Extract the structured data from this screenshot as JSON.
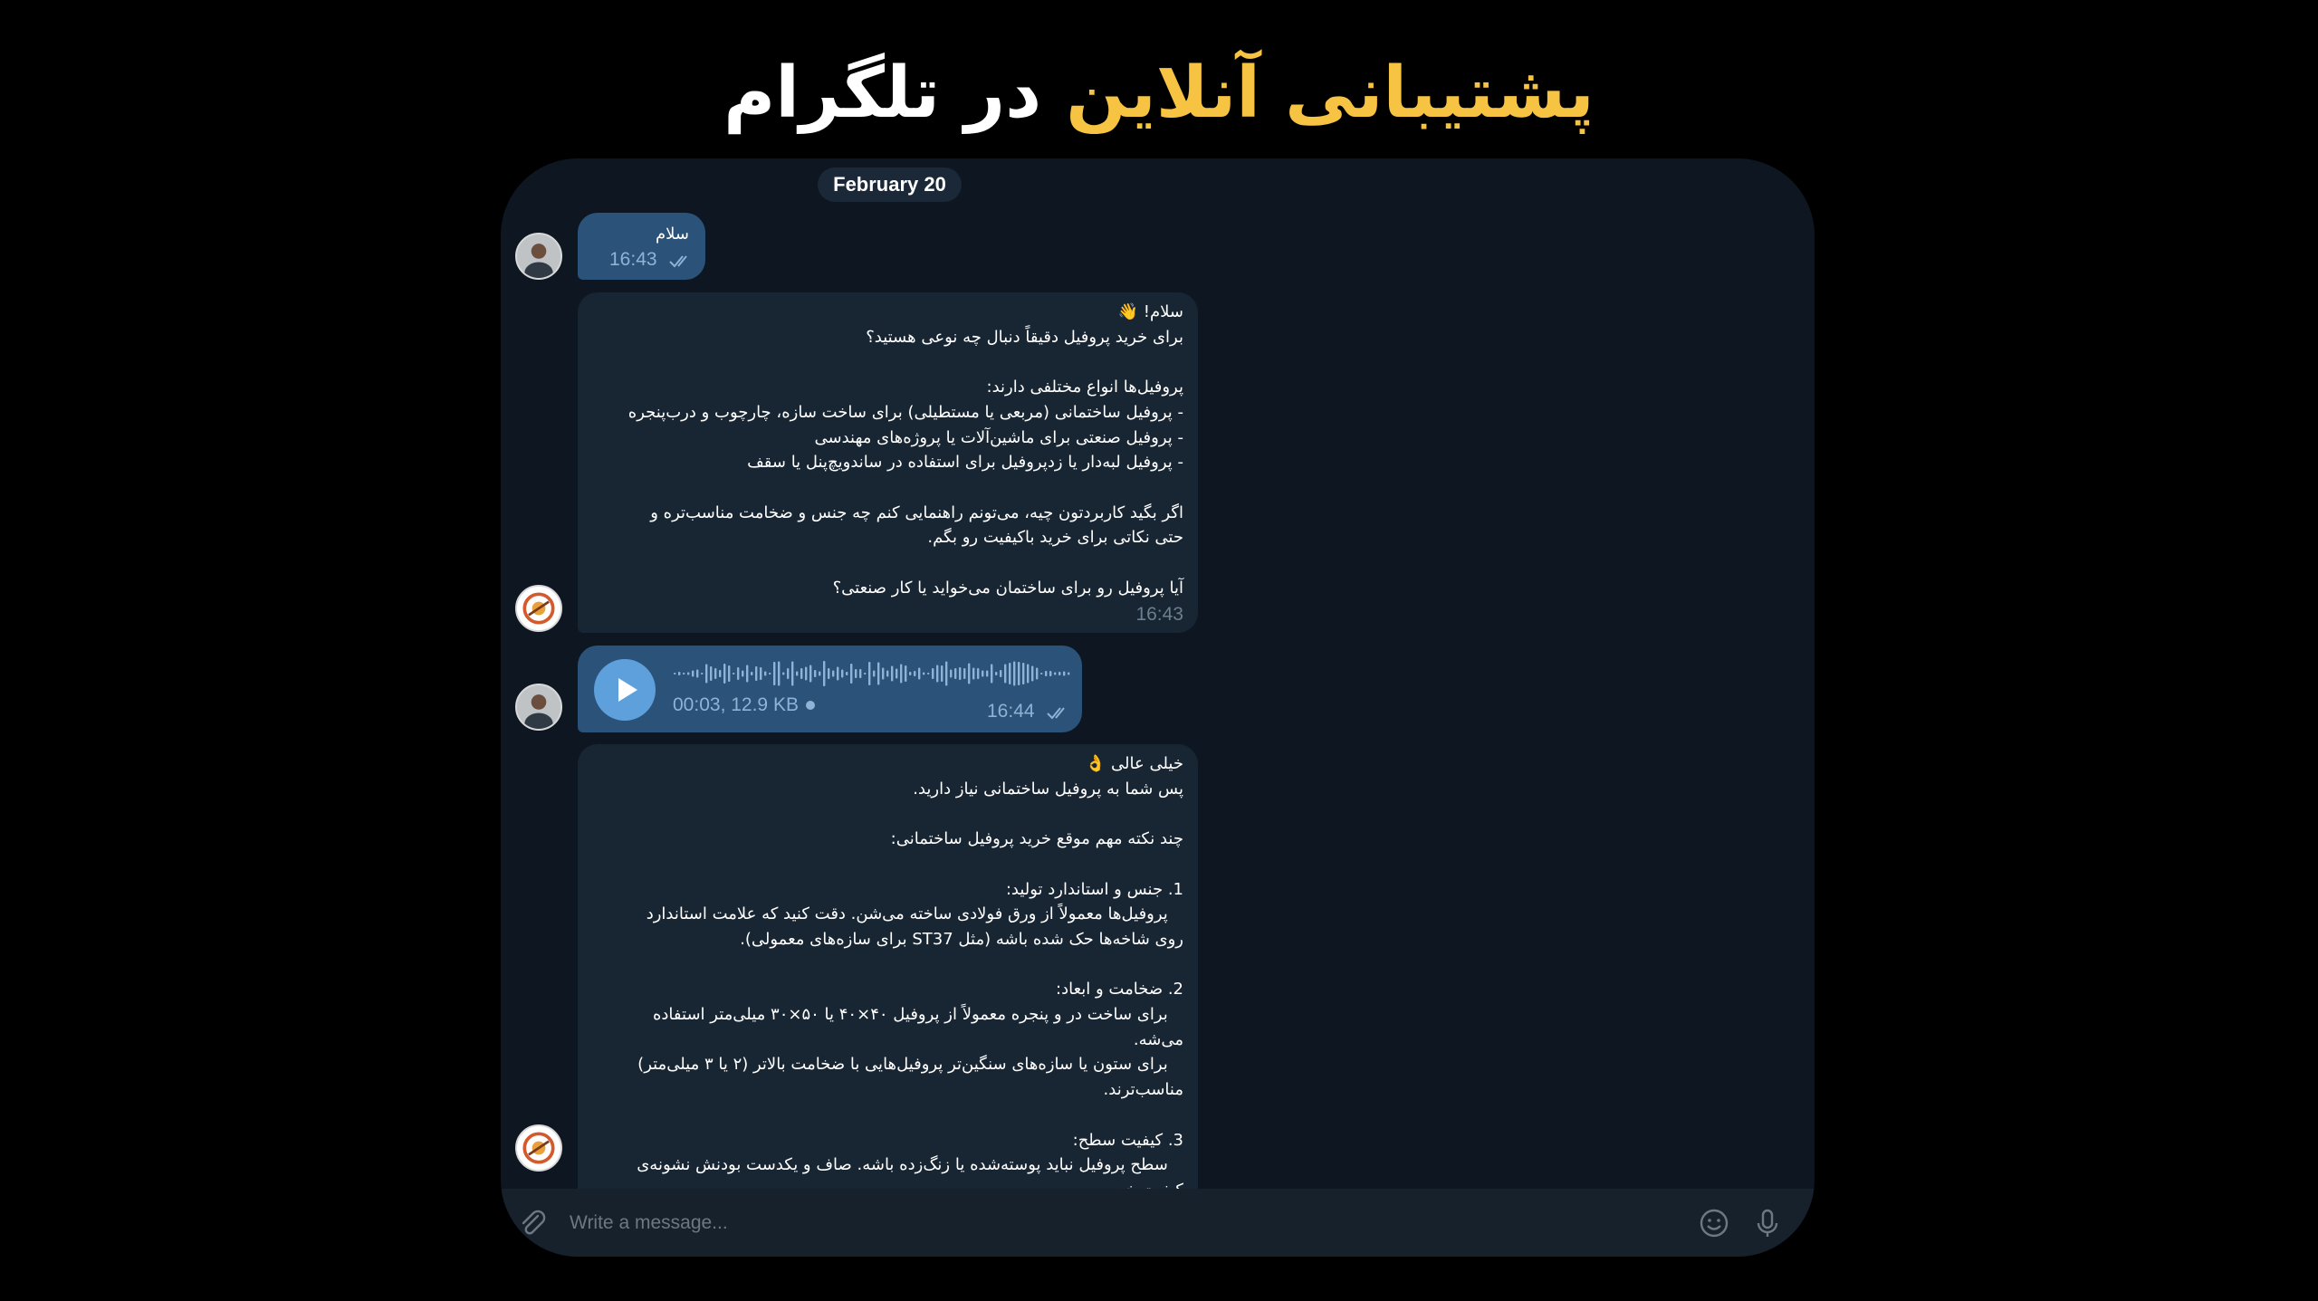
{
  "title": {
    "accent_text": "پشتیبانی آنلاین",
    "rest_text": " در تلگرام",
    "accent_color": "#f6c343"
  },
  "chat": {
    "date_label": "February 20",
    "composer_placeholder": "Write a message...",
    "messages": [
      {
        "direction": "outgoing",
        "text": "سلام",
        "time": "16:43",
        "status": "read"
      },
      {
        "direction": "incoming",
        "text": "سلام! 👋\nبرای خرید پروفیل دقیقاً دنبال چه نوعی هستید؟\n\nپروفیل‌ها انواع مختلفی دارند:\n- پروفیل ساختمانی (مربعی یا مستطیلی) برای ساخت سازه، چارچوب و درب‌پنجره\n- پروفیل صنعتی برای ماشین‌آلات یا پروژه‌های مهندسی\n- پروفیل لبه‌دار یا زدپروفیل برای استفاده در ساندویچ‌پنل یا سقف\n\nاگر بگید کاربردتون چیه، می‌تونم راهنمایی کنم چه جنس و ضخامت مناسب‌تره و\nحتی نکاتی برای خرید باکیفیت رو بگم.\n\nآیا پروفیل رو برای ساختمان می‌خواید یا کار صنعتی؟",
        "time": "16:43"
      },
      {
        "direction": "outgoing",
        "type": "voice",
        "duration": "00:03",
        "size": "12.9 KB",
        "time": "16:44",
        "status": "read"
      },
      {
        "direction": "incoming",
        "text": "خیلی عالی 👌\nپس شما به پروفیل ساختمانی نیاز دارید.\n\nچند نکته مهم موقع خرید پروفیل ساختمانی:\n\n1. جنس و استاندارد تولید:\n   پروفیل‌ها معمولاً از ورق فولادی ساخته می‌شن. دقت کنید که علامت استاندارد\nروی شاخه‌ها حک شده باشه (مثل ST37 برای سازه‌های معمولی).\n\n2. ضخامت و ابعاد:\n   برای ساخت در و پنجره معمولاً از پروفیل ۴۰×۴۰ یا ۵۰×۳۰ میلی‌متر استفاده\nمی‌شه.\n   برای ستون یا سازه‌های سنگین‌تر پروفیل‌هایی با ضخامت بالاتر (۲ یا ۳ میلی‌متر)\nمناسب‌ترند.\n\n3. کیفیت سطح:\n   سطح پروفیل نباید پوسته‌شده یا زنگ‌زده باشه. صاف و یکدست بودنش نشونه‌ی\nکیفیت خوبه.",
        "time": ""
      }
    ]
  },
  "colors": {
    "page_background": "#000000",
    "chat_background": "#0e1621",
    "outgoing_bubble": "#2b5278",
    "incoming_bubble": "#182533",
    "play_button": "#5ea0dc"
  },
  "icons": {
    "attach": "paperclip-icon",
    "emoji": "smiley-icon",
    "voice": "microphone-icon",
    "play": "play-icon",
    "read_status": "double-check-icon"
  }
}
